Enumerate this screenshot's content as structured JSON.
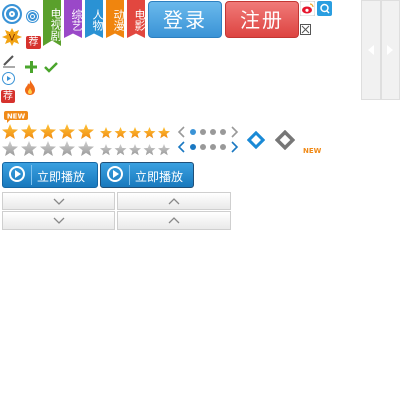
{
  "category_tags": [
    {
      "label": "电视剧",
      "color": "#5aa02c"
    },
    {
      "label": "综艺",
      "color": "#9a48c8"
    },
    {
      "label": "人物",
      "color": "#2a92d4"
    },
    {
      "label": "动漫",
      "color": "#f0850e"
    },
    {
      "label": "电影",
      "color": "#e2473f"
    }
  ],
  "buttons": {
    "login": "登录",
    "register": "注册",
    "play_now": "立即播放"
  },
  "badges": {
    "recommend": "荐",
    "vip": "V",
    "new": "NEW"
  },
  "rating": {
    "large_stars_filled": 5,
    "small_stars_filled": 5,
    "stars_total": 5
  },
  "colors": {
    "blue": "#3a93d6",
    "green": "#4aa52c",
    "red": "#d6322d",
    "orange": "#f2a313",
    "login_blue": "#4aa3df",
    "register_red": "#e25452"
  }
}
